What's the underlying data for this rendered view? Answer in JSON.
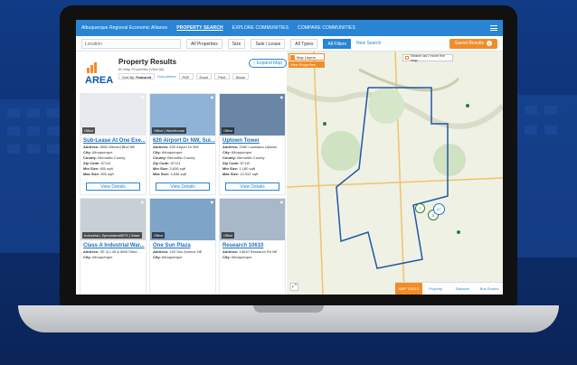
{
  "top_nav": {
    "brand": "Albuquerque Regional Economic Alliance",
    "items": [
      {
        "label": "PROPERTY SEARCH",
        "active": true
      },
      {
        "label": "EXPLORE COMMUNITIES",
        "active": false
      },
      {
        "label": "COMPARE COMMUNITIES",
        "active": false
      }
    ]
  },
  "filter_bar": {
    "location_placeholder": "Location",
    "property_type": "All Properties",
    "size": "Size",
    "sale_lease": "Sale / Lease",
    "all_types": "All Types",
    "all_filters": "All Filters",
    "new_search": "New Search",
    "saved_results": "Saved Results",
    "saved_count": "0"
  },
  "results": {
    "logo": "AREA",
    "title": "Property Results",
    "subtitle": "80 Map Properties (View All)",
    "expand_map": "Expand Map",
    "sort_by": "Sort By",
    "sort_value": "Featured",
    "documents": "Documents",
    "pdf": "PDF",
    "excel": "Excel",
    "print": "Print",
    "share": "Share"
  },
  "cards": [
    {
      "title": "Sub-Lease At One Exe...",
      "tag": "Office",
      "address": "8500 Menaul Blvd NE",
      "city": "Albuquerque",
      "county": "Bernalillo County",
      "zip": "87112",
      "min_size": "800 sqft",
      "max_size": "800 sqft",
      "view": "View Details",
      "photo_color": "#e7eaee"
    },
    {
      "title": "620 Airport Dr NW, Sui...",
      "tag": "Office | Warehouse",
      "address": "620 Airport Dr NW",
      "city": "Albuquerque",
      "county": "Bernalillo County",
      "zip": "87121",
      "min_size": "3,636 sqft",
      "max_size": "3,636 sqft",
      "view": "View Details",
      "photo_color": "#8fb3d6"
    },
    {
      "title": "Uptown Tower",
      "tag": "Office",
      "address": "2440 Louisiana Uptown",
      "city": "Albuquerque",
      "county": "Bernalillo County",
      "zip": "87110",
      "min_size": "1,180 sqft",
      "max_size": "22,531 sqft",
      "view": "View Details",
      "photo_color": "#6a86a6"
    },
    {
      "title": "Class A Industrial War...",
      "tag": "Industrial | Specialized/BTS | Ware",
      "address": "SE Q-I-45 & 86th Stree...",
      "city": "Albuquerque",
      "county": "",
      "zip": "",
      "min_size": "",
      "max_size": "",
      "view": "",
      "photo_color": "#c9cfd6"
    },
    {
      "title": "One Sun Plaza",
      "tag": "Office",
      "address": "100 Sun Avenue NE",
      "city": "Albuquerque",
      "county": "",
      "zip": "",
      "min_size": "",
      "max_size": "",
      "view": "",
      "photo_color": "#7ea4c8"
    },
    {
      "title": "Research 10610",
      "tag": "Office",
      "address": "10610 Research Rd NE",
      "city": "Albuquerque",
      "county": "",
      "zip": "",
      "min_size": "",
      "max_size": "",
      "view": "",
      "photo_color": "#a8b8c9"
    }
  ],
  "card_labels": {
    "address": "Address:",
    "city": "City:",
    "county": "County:",
    "zip": "Zip Code:",
    "min": "Min Size:",
    "max": "Max Size:"
  },
  "map": {
    "layers": "Map Layers",
    "properties": "View Properties",
    "search_on_move": "Search as I move the map",
    "clusters": [
      "47",
      "2",
      "8"
    ],
    "bottom": [
      "MAP TOOLS",
      "Property",
      "Distance",
      "Bus Routes"
    ]
  }
}
